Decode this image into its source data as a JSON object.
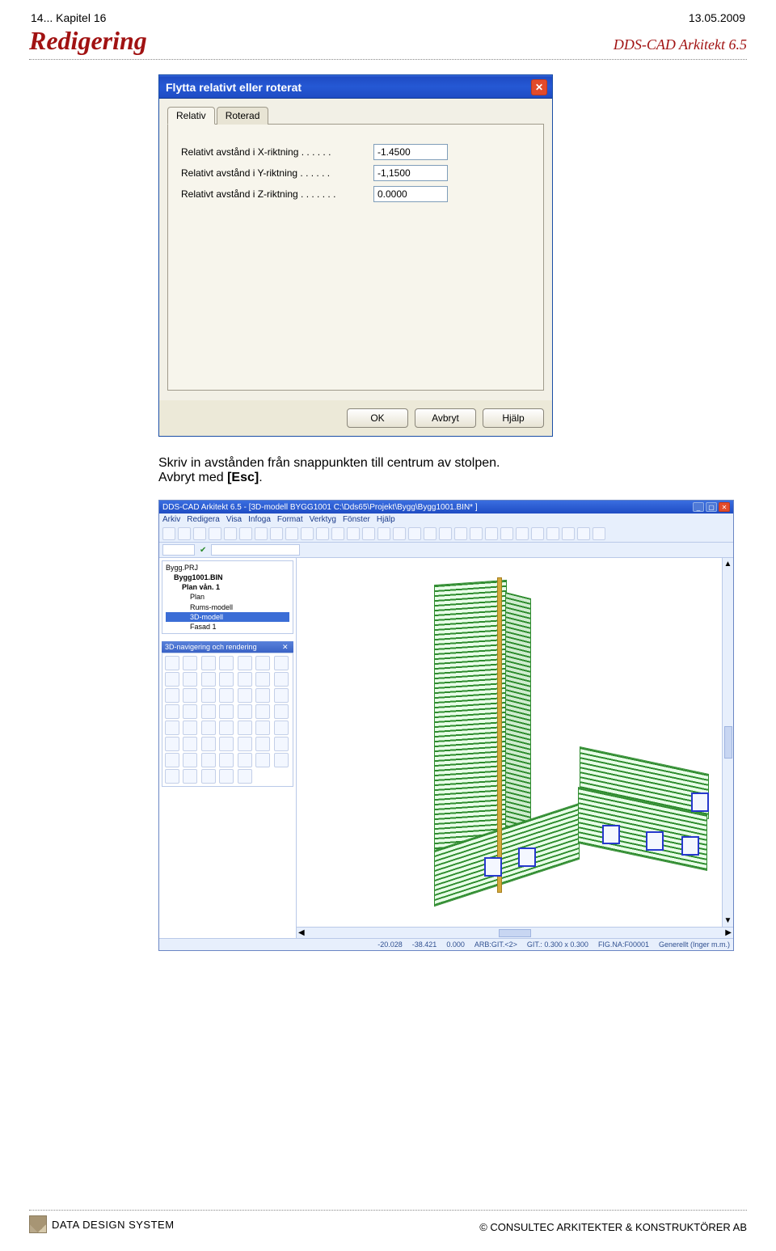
{
  "header": {
    "left": "14... Kapitel 16",
    "right": "13.05.2009",
    "title_left": "Redigering",
    "title_right": "DDS-CAD Arkitekt 6.5"
  },
  "dialog": {
    "title": "Flytta relativt eller roterat",
    "tabs": {
      "relativ": "Relativ",
      "roterad": "Roterad"
    },
    "fields": {
      "x": {
        "label": "Relativt avstånd i X-riktning . . . . . .",
        "value": "-1.4500"
      },
      "y": {
        "label": "Relativt avstånd i Y-riktning . . . . . .",
        "value": "-1,1500"
      },
      "z": {
        "label": "Relativt avstånd i Z-riktning . . . . . . .",
        "value": "0.0000"
      }
    },
    "buttons": {
      "ok": "OK",
      "cancel": "Avbryt",
      "help": "Hjälp"
    }
  },
  "caption": {
    "line1": "Skriv in avstånden från snappunkten till centrum av stolpen.",
    "line2_prefix": "Avbryt med ",
    "esc": "[Esc]",
    "line2_suffix": "."
  },
  "cad": {
    "title": "DDS-CAD Arkitekt 6.5 - [3D-modell  BYGG1001  C:\\Dds65\\Projekt\\Bygg\\Bygg1001.BIN* ]",
    "menu": [
      "Arkiv",
      "Redigera",
      "Visa",
      "Infoga",
      "Format",
      "Verktyg",
      "Fönster",
      "Hjälp"
    ],
    "tree": {
      "root": "Bygg.PRJ",
      "file": "Bygg1001.BIN",
      "plan_group": "Plan vån. 1",
      "plan": "Plan",
      "rums": "Rums-modell",
      "model3d": "3D-modell",
      "fasad": "Fasad 1"
    },
    "palette_title": "3D-navigering och rendering",
    "status": {
      "x": "-20.028",
      "y": "-38.421",
      "z": "0.000",
      "arb": "ARB:GIT.<2>",
      "git": "GIT.: 0.300 x 0.300",
      "fig": "FIG.NA:F00001",
      "gen": "Generellt (Inger m.m.)"
    }
  },
  "footer": {
    "dds": "DATA DESIGN SYSTEM",
    "company_prefix": "© ",
    "company": "CONSULTEC ARKITEKTER & KONSTRUKTÖRER AB"
  }
}
